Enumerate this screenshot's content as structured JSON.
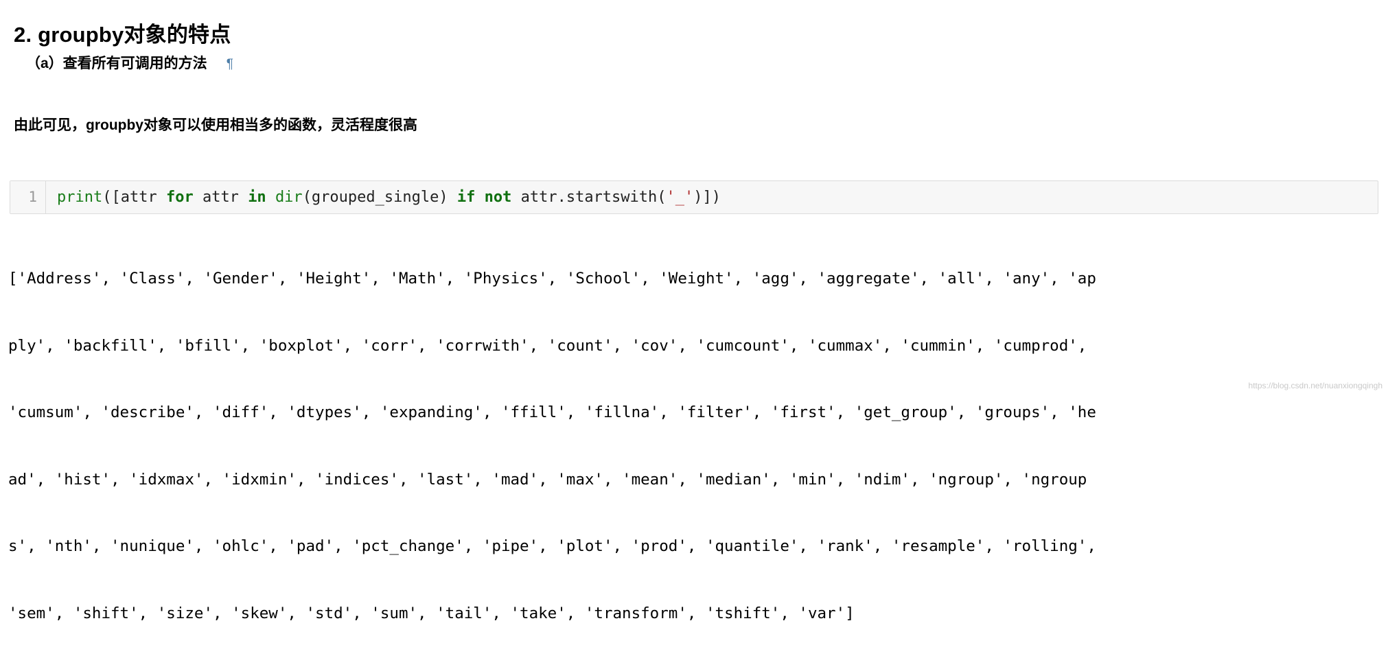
{
  "heading": {
    "section_title": "2. groupby对象的特点",
    "subsection_title": "（a）查看所有可调用的方法",
    "anchor_symbol": "¶"
  },
  "paragraph": {
    "text": "由此可见，groupby对象可以使用相当多的函数，灵活程度很高"
  },
  "code_cell": {
    "line_number": "1",
    "tokens": [
      {
        "text": "print",
        "kind": "fn"
      },
      {
        "text": "([attr ",
        "kind": "plain"
      },
      {
        "text": "for",
        "kind": "kw"
      },
      {
        "text": " attr ",
        "kind": "plain"
      },
      {
        "text": "in",
        "kind": "kw"
      },
      {
        "text": " ",
        "kind": "plain"
      },
      {
        "text": "dir",
        "kind": "fn"
      },
      {
        "text": "(grouped_single) ",
        "kind": "plain"
      },
      {
        "text": "if",
        "kind": "kw"
      },
      {
        "text": " ",
        "kind": "plain"
      },
      {
        "text": "not",
        "kind": "kw"
      },
      {
        "text": " attr.startswith(",
        "kind": "plain"
      },
      {
        "text": "'_'",
        "kind": "str"
      },
      {
        "text": ")])",
        "kind": "plain"
      }
    ],
    "plain_text": "print([attr for attr in dir(grouped_single) if not attr.startswith('_')])"
  },
  "output": {
    "lines": [
      "['Address', 'Class', 'Gender', 'Height', 'Math', 'Physics', 'School', 'Weight', 'agg', 'aggregate', 'all', 'any', 'ap",
      "ply', 'backfill', 'bfill', 'boxplot', 'corr', 'corrwith', 'count', 'cov', 'cumcount', 'cummax', 'cummin', 'cumprod',",
      "'cumsum', 'describe', 'diff', 'dtypes', 'expanding', 'ffill', 'fillna', 'filter', 'first', 'get_group', 'groups', 'he",
      "ad', 'hist', 'idxmax', 'idxmin', 'indices', 'last', 'mad', 'max', 'mean', 'median', 'min', 'ndim', 'ngroup', 'ngroup",
      "s', 'nth', 'nunique', 'ohlc', 'pad', 'pct_change', 'pipe', 'plot', 'prod', 'quantile', 'rank', 'resample', 'rolling',",
      "'sem', 'shift', 'size', 'skew', 'std', 'sum', 'tail', 'take', 'transform', 'tshift', 'var']"
    ],
    "methods": [
      "Address",
      "Class",
      "Gender",
      "Height",
      "Math",
      "Physics",
      "School",
      "Weight",
      "agg",
      "aggregate",
      "all",
      "any",
      "apply",
      "backfill",
      "bfill",
      "boxplot",
      "corr",
      "corrwith",
      "count",
      "cov",
      "cumcount",
      "cummax",
      "cummin",
      "cumprod",
      "cumsum",
      "describe",
      "diff",
      "dtypes",
      "expanding",
      "ffill",
      "fillna",
      "filter",
      "first",
      "get_group",
      "groups",
      "head",
      "hist",
      "idxmax",
      "idxmin",
      "indices",
      "last",
      "mad",
      "max",
      "mean",
      "median",
      "min",
      "ndim",
      "ngroup",
      "ngroups",
      "nth",
      "nunique",
      "ohlc",
      "pad",
      "pct_change",
      "pipe",
      "plot",
      "prod",
      "quantile",
      "rank",
      "resample",
      "rolling",
      "sem",
      "shift",
      "size",
      "skew",
      "std",
      "sum",
      "tail",
      "take",
      "transform",
      "tshift",
      "var"
    ]
  },
  "watermark": {
    "text": "https://blog.csdn.net/nuanxiongqingh"
  },
  "colors": {
    "anchor": "#4d7ea8",
    "code_bg": "#f7f7f7",
    "code_border": "#dcdcdc",
    "gutter_text": "#999999",
    "keyword": "#107010",
    "function": "#1a7d1a",
    "string": "#b03030",
    "watermark": "#c9c9c9"
  }
}
